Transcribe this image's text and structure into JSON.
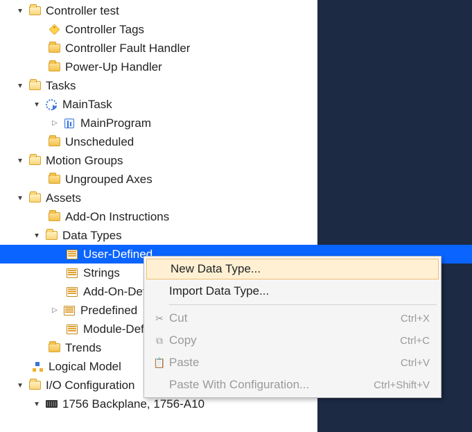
{
  "tree": {
    "controller_test": "Controller test",
    "controller_tags": "Controller Tags",
    "fault_handler": "Controller Fault Handler",
    "powerup_handler": "Power-Up Handler",
    "tasks": "Tasks",
    "maintask": "MainTask",
    "mainprogram": "MainProgram",
    "unscheduled": "Unscheduled",
    "motion_groups": "Motion Groups",
    "ungrouped_axes": "Ungrouped Axes",
    "assets": "Assets",
    "addon_instructions": "Add-On Instructions",
    "data_types": "Data Types",
    "user_defined": "User-Defined",
    "strings": "Strings",
    "addon_defined": "Add-On-Defined",
    "predefined": "Predefined",
    "module_defined": "Module-Defined",
    "trends": "Trends",
    "logical_model": "Logical Model",
    "io_config": "I/O Configuration",
    "backplane": "1756 Backplane, 1756-A10"
  },
  "menu": {
    "new_data_type": "New Data Type...",
    "import_data_type": "Import Data Type...",
    "cut": "Cut",
    "cut_sc": "Ctrl+X",
    "copy": "Copy",
    "copy_sc": "Ctrl+C",
    "paste": "Paste",
    "paste_sc": "Ctrl+V",
    "paste_config": "Paste With Configuration...",
    "paste_config_sc": "Ctrl+Shift+V"
  }
}
